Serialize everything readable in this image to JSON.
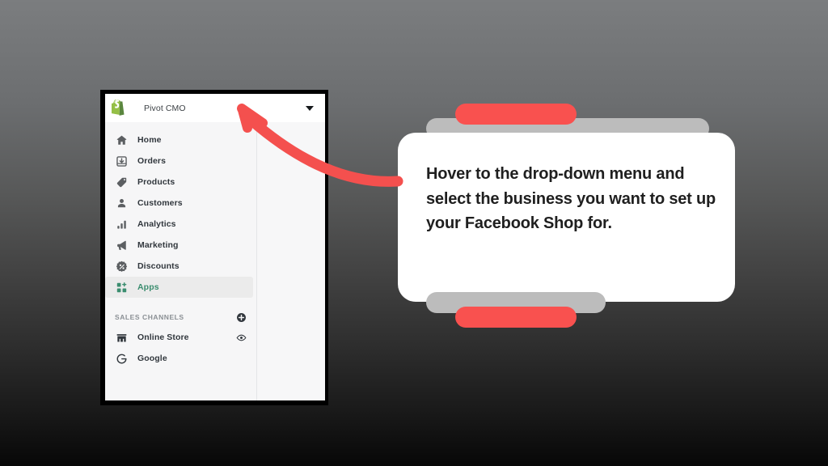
{
  "background": {
    "gradient_top": "#7b7d7f",
    "gradient_bottom": "#070707"
  },
  "app_window": {
    "topbar": {
      "logo_icon": "shopify-logo-icon",
      "store_name": "Pivot CMO",
      "dropdown_icon": "caret-down-icon"
    },
    "sidebar": {
      "items": [
        {
          "label": "Home",
          "icon": "home-icon",
          "active": false
        },
        {
          "label": "Orders",
          "icon": "orders-inbox-icon",
          "active": false
        },
        {
          "label": "Products",
          "icon": "tag-icon",
          "active": false
        },
        {
          "label": "Customers",
          "icon": "person-icon",
          "active": false
        },
        {
          "label": "Analytics",
          "icon": "bar-chart-icon",
          "active": false
        },
        {
          "label": "Marketing",
          "icon": "megaphone-icon",
          "active": false
        },
        {
          "label": "Discounts",
          "icon": "discount-percent-icon",
          "active": false
        },
        {
          "label": "Apps",
          "icon": "apps-grid-plus-icon",
          "active": true
        }
      ],
      "active_color": "#3b8d6f",
      "section": {
        "title": "SALES CHANNELS",
        "add_icon": "plus-circle-icon",
        "channels": [
          {
            "label": "Online Store",
            "icon": "storefront-icon",
            "trailing_icon": "eye-icon"
          },
          {
            "label": "Google",
            "icon": "google-g-icon",
            "trailing_icon": ""
          }
        ]
      }
    }
  },
  "annotation": {
    "arrow_icon": "curved-arrow-icon",
    "arrow_color": "#f4504e",
    "callout_text": "Hover to the drop-down menu and select the business you want to set up your Facebook Shop for.",
    "decorations": {
      "red": "#f9514f",
      "gray": "#bcbcbc",
      "card": "#ffffff"
    }
  }
}
